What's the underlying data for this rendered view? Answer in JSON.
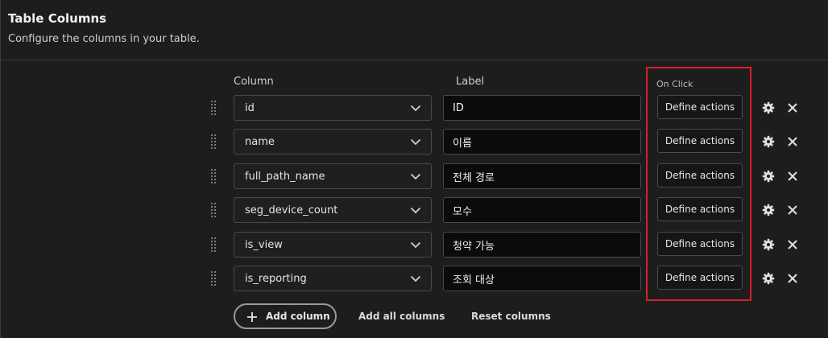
{
  "header": {
    "title": "Table Columns",
    "subtitle": "Configure the columns in your table."
  },
  "columns_header": {
    "column": "Column",
    "label": "Label",
    "on_click": "On Click"
  },
  "rows": [
    {
      "column": "id",
      "label": "ID",
      "action": "Define actions"
    },
    {
      "column": "name",
      "label": "이름",
      "action": "Define actions"
    },
    {
      "column": "full_path_name",
      "label": "전체 경로",
      "action": "Define actions"
    },
    {
      "column": "seg_device_count",
      "label": "모수",
      "action": "Define actions"
    },
    {
      "column": "is_view",
      "label": "청약 가능",
      "action": "Define actions"
    },
    {
      "column": "is_reporting",
      "label": "조회 대상",
      "action": "Define actions"
    }
  ],
  "footer": {
    "add_column": "Add column",
    "add_all_columns": "Add all columns",
    "reset_columns": "Reset columns"
  },
  "colors": {
    "background": "#1d1d1d",
    "highlight": "#d6202b",
    "input_background": "#0b0b0b"
  },
  "icons": [
    "drag-handle-icon",
    "chevron-down-icon",
    "gear-icon",
    "close-icon",
    "plus-icon"
  ]
}
